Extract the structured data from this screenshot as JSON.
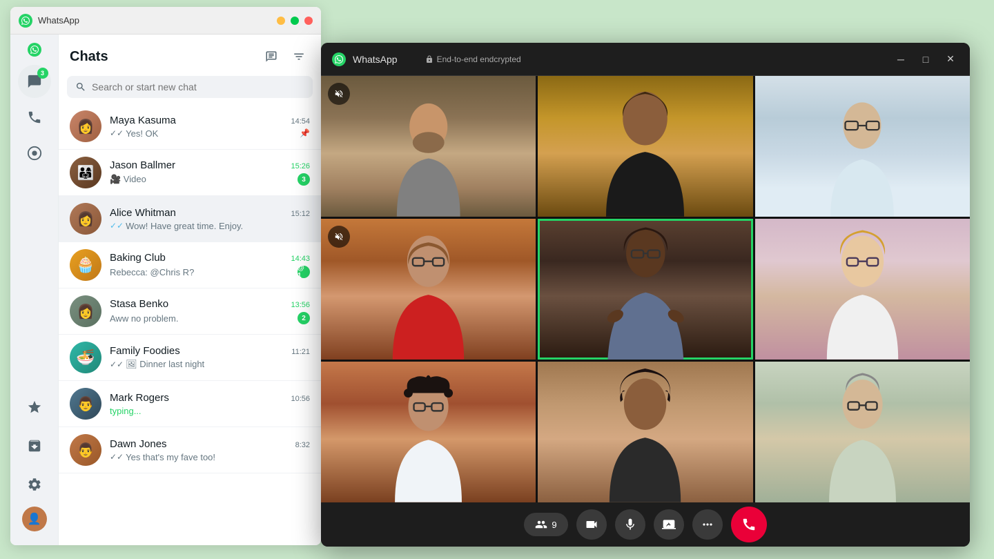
{
  "app": {
    "name": "WhatsApp",
    "titleBar": {
      "title": "WhatsApp",
      "minimizeLabel": "minimize",
      "maximizeLabel": "maximize",
      "closeLabel": "close"
    }
  },
  "sidebar": {
    "badge": "3",
    "icons": [
      {
        "name": "chats-icon",
        "symbol": "💬",
        "active": true,
        "badge": "3"
      },
      {
        "name": "calls-icon",
        "symbol": "📞",
        "active": false
      },
      {
        "name": "status-icon",
        "symbol": "⊙",
        "active": false
      }
    ],
    "bottomIcons": [
      {
        "name": "starred-icon",
        "symbol": "★"
      },
      {
        "name": "archived-icon",
        "symbol": "⬜"
      },
      {
        "name": "settings-icon",
        "symbol": "⚙"
      }
    ]
  },
  "chatPanel": {
    "title": "Chats",
    "newChatLabel": "✏",
    "filterLabel": "≡",
    "searchPlaceholder": "Search or start new chat",
    "chats": [
      {
        "id": "maya-kasuma",
        "name": "Maya Kasuma",
        "time": "14:54",
        "preview": "Yes! OK",
        "tick": "double",
        "tickColor": "grey",
        "pinned": true,
        "unread": 0,
        "avatarColor": "#c49060",
        "avatarEmoji": "👩"
      },
      {
        "id": "jason-ballmer",
        "name": "Jason Ballmer",
        "time": "15:26",
        "preview": "🎥 Video",
        "tick": "",
        "tickColor": "",
        "pinned": false,
        "unread": 3,
        "timeColor": "green",
        "avatarColor": "#8B6040",
        "avatarEmoji": "👨‍👩"
      },
      {
        "id": "alice-whitman",
        "name": "Alice Whitman",
        "time": "15:12",
        "preview": "Wow! Have great time. Enjoy.",
        "tick": "double",
        "tickColor": "blue",
        "pinned": false,
        "unread": 0,
        "active": true,
        "avatarColor": "#a07850",
        "avatarEmoji": "👩"
      },
      {
        "id": "baking-club",
        "name": "Baking Club",
        "time": "14:43",
        "preview": "Rebecca: @Chris R?",
        "tick": "",
        "tickColor": "",
        "pinned": false,
        "unread": 1,
        "timeColor": "green",
        "mention": true,
        "avatarColor": "#e8a020",
        "avatarEmoji": "🧁"
      },
      {
        "id": "stasa-benko",
        "name": "Stasa Benko",
        "time": "13:56",
        "preview": "Aww no problem.",
        "tick": "",
        "tickColor": "",
        "pinned": false,
        "unread": 2,
        "timeColor": "green",
        "avatarColor": "#7a9080",
        "avatarEmoji": "👩"
      },
      {
        "id": "family-foodies",
        "name": "Family Foodies",
        "time": "11:21",
        "preview": "Dinner last night",
        "tick": "double",
        "tickColor": "grey",
        "pinned": false,
        "unread": 0,
        "avatarColor": "#30b8a8",
        "avatarEmoji": "🍜"
      },
      {
        "id": "mark-rogers",
        "name": "Mark Rogers",
        "time": "10:56",
        "preview": "typing...",
        "isTyping": true,
        "tick": "",
        "tickColor": "",
        "pinned": false,
        "unread": 0,
        "avatarColor": "#507890",
        "avatarEmoji": "👨"
      },
      {
        "id": "dawn-jones",
        "name": "Dawn Jones",
        "time": "8:32",
        "preview": "Yes that's my fave too!",
        "tick": "double",
        "tickColor": "grey",
        "pinned": false,
        "unread": 0,
        "avatarColor": "#c07848",
        "avatarEmoji": "👨"
      }
    ]
  },
  "videoCall": {
    "titleBarTitle": "WhatsApp",
    "e2eLabel": "End-to-end endcrypted",
    "participants": 9,
    "participantsLabel": "9",
    "controls": {
      "participantsBtn": "9",
      "videoBtn": "video",
      "micBtn": "mic",
      "screenShareBtn": "screen",
      "moreBtn": "...",
      "endCallBtn": "end"
    },
    "grid": [
      {
        "id": 1,
        "muted": true,
        "highlighted": false
      },
      {
        "id": 2,
        "muted": false,
        "highlighted": false
      },
      {
        "id": 3,
        "muted": false,
        "highlighted": false
      },
      {
        "id": 4,
        "muted": true,
        "highlighted": false
      },
      {
        "id": 5,
        "muted": false,
        "highlighted": true
      },
      {
        "id": 6,
        "muted": false,
        "highlighted": false
      },
      {
        "id": 7,
        "muted": false,
        "highlighted": false
      },
      {
        "id": 8,
        "muted": false,
        "highlighted": false
      },
      {
        "id": 9,
        "muted": false,
        "highlighted": false
      }
    ]
  },
  "colors": {
    "whatsappGreen": "#25d366",
    "endCallRed": "#ea0038",
    "unreadGreen": "#25d366",
    "darkBg": "#1a1a1a",
    "lightBg": "#f0f2f5"
  }
}
